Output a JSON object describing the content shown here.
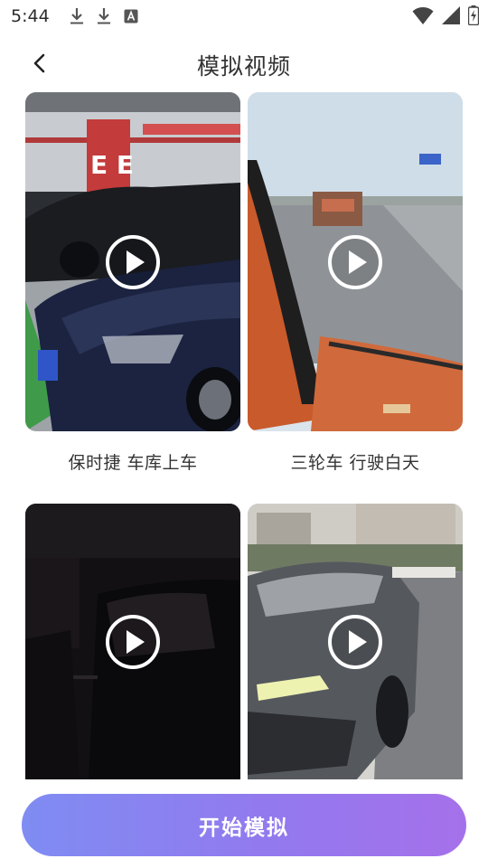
{
  "status_bar": {
    "time": "5:44",
    "left_icons": [
      "download-icon",
      "download-icon",
      "text-a-icon"
    ],
    "right_icons": [
      "wifi-icon",
      "cellular-signal-icon",
      "battery-charging-icon"
    ]
  },
  "header": {
    "title": "模拟视频",
    "back_icon": "chevron-left-icon"
  },
  "videos": [
    {
      "label": "保时捷 车库上车",
      "icon": "play-icon"
    },
    {
      "label": "三轮车 行驶白天",
      "icon": "play-icon"
    },
    {
      "label": "",
      "icon": "play-icon"
    },
    {
      "label": "",
      "icon": "play-icon"
    }
  ],
  "bottom": {
    "start_label": "开始模拟"
  },
  "colors": {
    "button_gradient_start": "#7f8cf2",
    "button_gradient_end": "#a571ea",
    "background": "#ffffff",
    "text": "#333333"
  }
}
